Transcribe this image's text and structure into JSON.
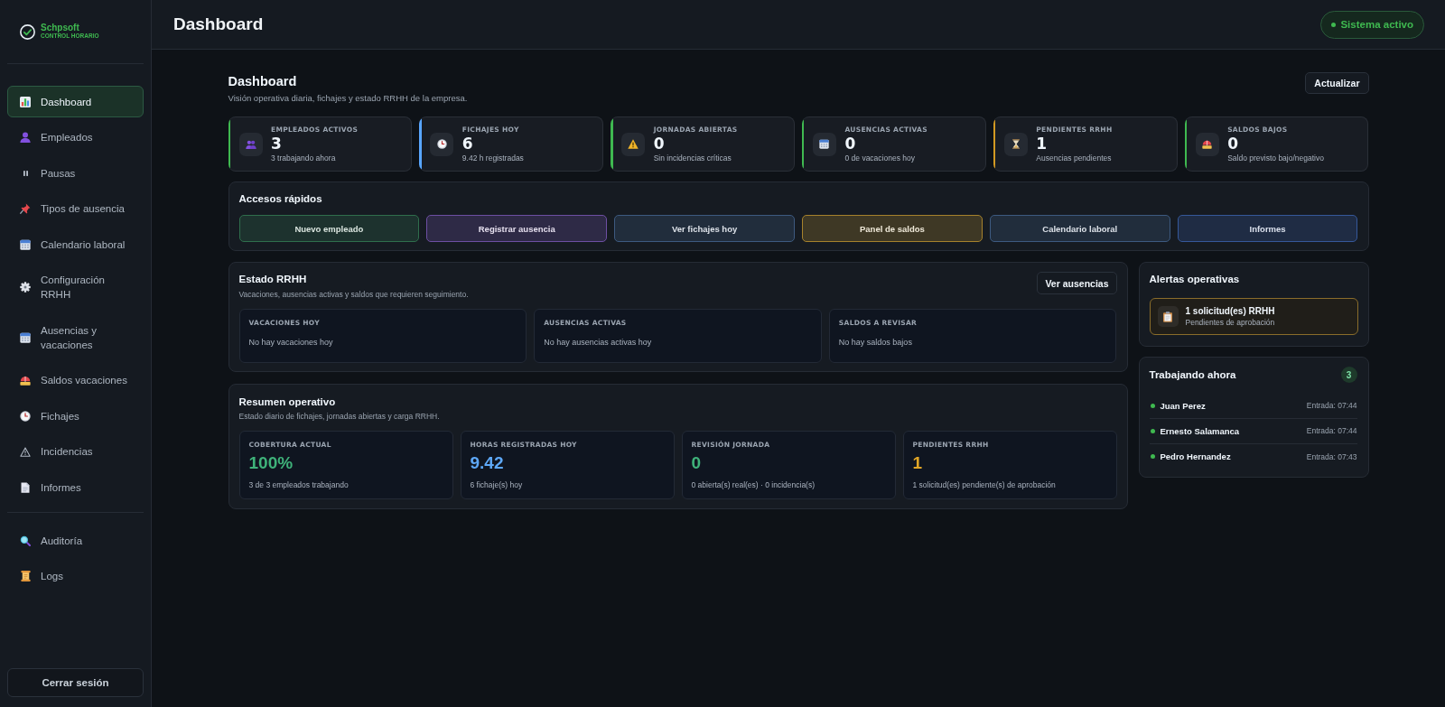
{
  "sidebar": {
    "brand": {
      "name": "Schpsoft",
      "tagline": "CONTROL HORARIO"
    },
    "nav": [
      {
        "label": "Dashboard",
        "selected": true
      },
      {
        "label": "Empleados",
        "selected": false
      },
      {
        "label": "Pausas",
        "selected": false
      },
      {
        "label": "Tipos de ausencia",
        "selected": false
      },
      {
        "label": "Calendario laboral",
        "selected": false
      },
      {
        "label": "Configuración RRHH",
        "selected": false
      },
      {
        "label": "Ausencias y vacaciones",
        "selected": false
      },
      {
        "label": "Saldos vacaciones",
        "selected": false
      },
      {
        "label": "Fichajes",
        "selected": false
      },
      {
        "label": "Incidencias",
        "selected": false
      },
      {
        "label": "Informes",
        "selected": false
      }
    ],
    "admin": [
      {
        "label": "Auditoría",
        "selected": false
      },
      {
        "label": "Logs",
        "selected": false
      }
    ],
    "logout": "Cerrar sesión"
  },
  "header": {
    "title": "Dashboard",
    "status": "Sistema activo"
  },
  "page": {
    "title": "Dashboard",
    "subtitle": "Visión operativa diaria, fichajes y estado RRHH de la empresa.",
    "refresh": "Actualizar"
  },
  "stats": [
    {
      "label": "EMPLEADOS ACTIVOS",
      "value": "3",
      "note": "3 trabajando ahora",
      "color": "#3fb950"
    },
    {
      "label": "FICHAJES HOY",
      "value": "6",
      "note": "9.42 h registradas",
      "color": "#58a6ff"
    },
    {
      "label": "JORNADAS ABIERTAS",
      "value": "0",
      "note": "Sin incidencias críticas",
      "color": "#3fb950"
    },
    {
      "label": "AUSENCIAS ACTIVAS",
      "value": "0",
      "note": "0 de vacaciones hoy",
      "color": "#3fb950"
    },
    {
      "label": "PENDIENTES RRHH",
      "value": "1",
      "note": "Ausencias pendientes",
      "color": "#d29922"
    },
    {
      "label": "SALDOS BAJOS",
      "value": "0",
      "note": "Saldo previsto bajo/negativo",
      "color": "#3fb950"
    }
  ],
  "quick_access": {
    "title": "Accesos rápidos",
    "buttons": [
      {
        "label": "Nuevo empleado",
        "color": "#2f6e4c"
      },
      {
        "label": "Registrar ausencia",
        "color": "#6d4fa3"
      },
      {
        "label": "Ver fichajes hoy",
        "color": "#3d5a80"
      },
      {
        "label": "Panel de saldos",
        "color": "#a6822c"
      },
      {
        "label": "Calendario laboral",
        "color": "#3d5a80"
      },
      {
        "label": "Informes",
        "color": "#35589a"
      }
    ]
  },
  "hr_status": {
    "title": "Estado RRHH",
    "subtitle": "Vacaciones, ausencias activas y saldos que requieren seguimiento.",
    "action": "Ver ausencias",
    "boxes": [
      {
        "label": "VACACIONES HOY",
        "text": "No hay vacaciones hoy"
      },
      {
        "label": "AUSENCIAS ACTIVAS",
        "text": "No hay ausencias activas hoy"
      },
      {
        "label": "SALDOS A REVISAR",
        "text": "No hay saldos bajos"
      }
    ]
  },
  "summary": {
    "title": "Resumen operativo",
    "subtitle": "Estado diario de fichajes, jornadas abiertas y carga RRHH.",
    "metrics": [
      {
        "label": "COBERTURA ACTUAL",
        "value": "100%",
        "note": "3 de 3 empleados trabajando",
        "color": "#3fb27a"
      },
      {
        "label": "HORAS REGISTRADAS HOY",
        "value": "9.42",
        "note": "6 fichaje(s) hoy",
        "color": "#5ea8f7"
      },
      {
        "label": "REVISIÓN JORNADA",
        "value": "0",
        "note": "0 abierta(s) real(es) · 0 incidencia(s)",
        "color": "#3fb27a"
      },
      {
        "label": "PENDIENTES RRHH",
        "value": "1",
        "note": "1 solicitud(es) pendiente(s) de aprobación",
        "color": "#e0a526"
      }
    ]
  },
  "alerts": {
    "title": "Alertas operativas",
    "items": [
      {
        "title": "1 solicitud(es) RRHH",
        "note": "Pendientes de aprobación"
      }
    ]
  },
  "working_now": {
    "title": "Trabajando ahora",
    "count": "3",
    "people": [
      {
        "name": "Juan Perez",
        "entry": "Entrada: 07:44"
      },
      {
        "name": "Ernesto Salamanca",
        "entry": "Entrada: 07:44"
      },
      {
        "name": "Pedro Hernandez",
        "entry": "Entrada: 07:43"
      }
    ]
  }
}
